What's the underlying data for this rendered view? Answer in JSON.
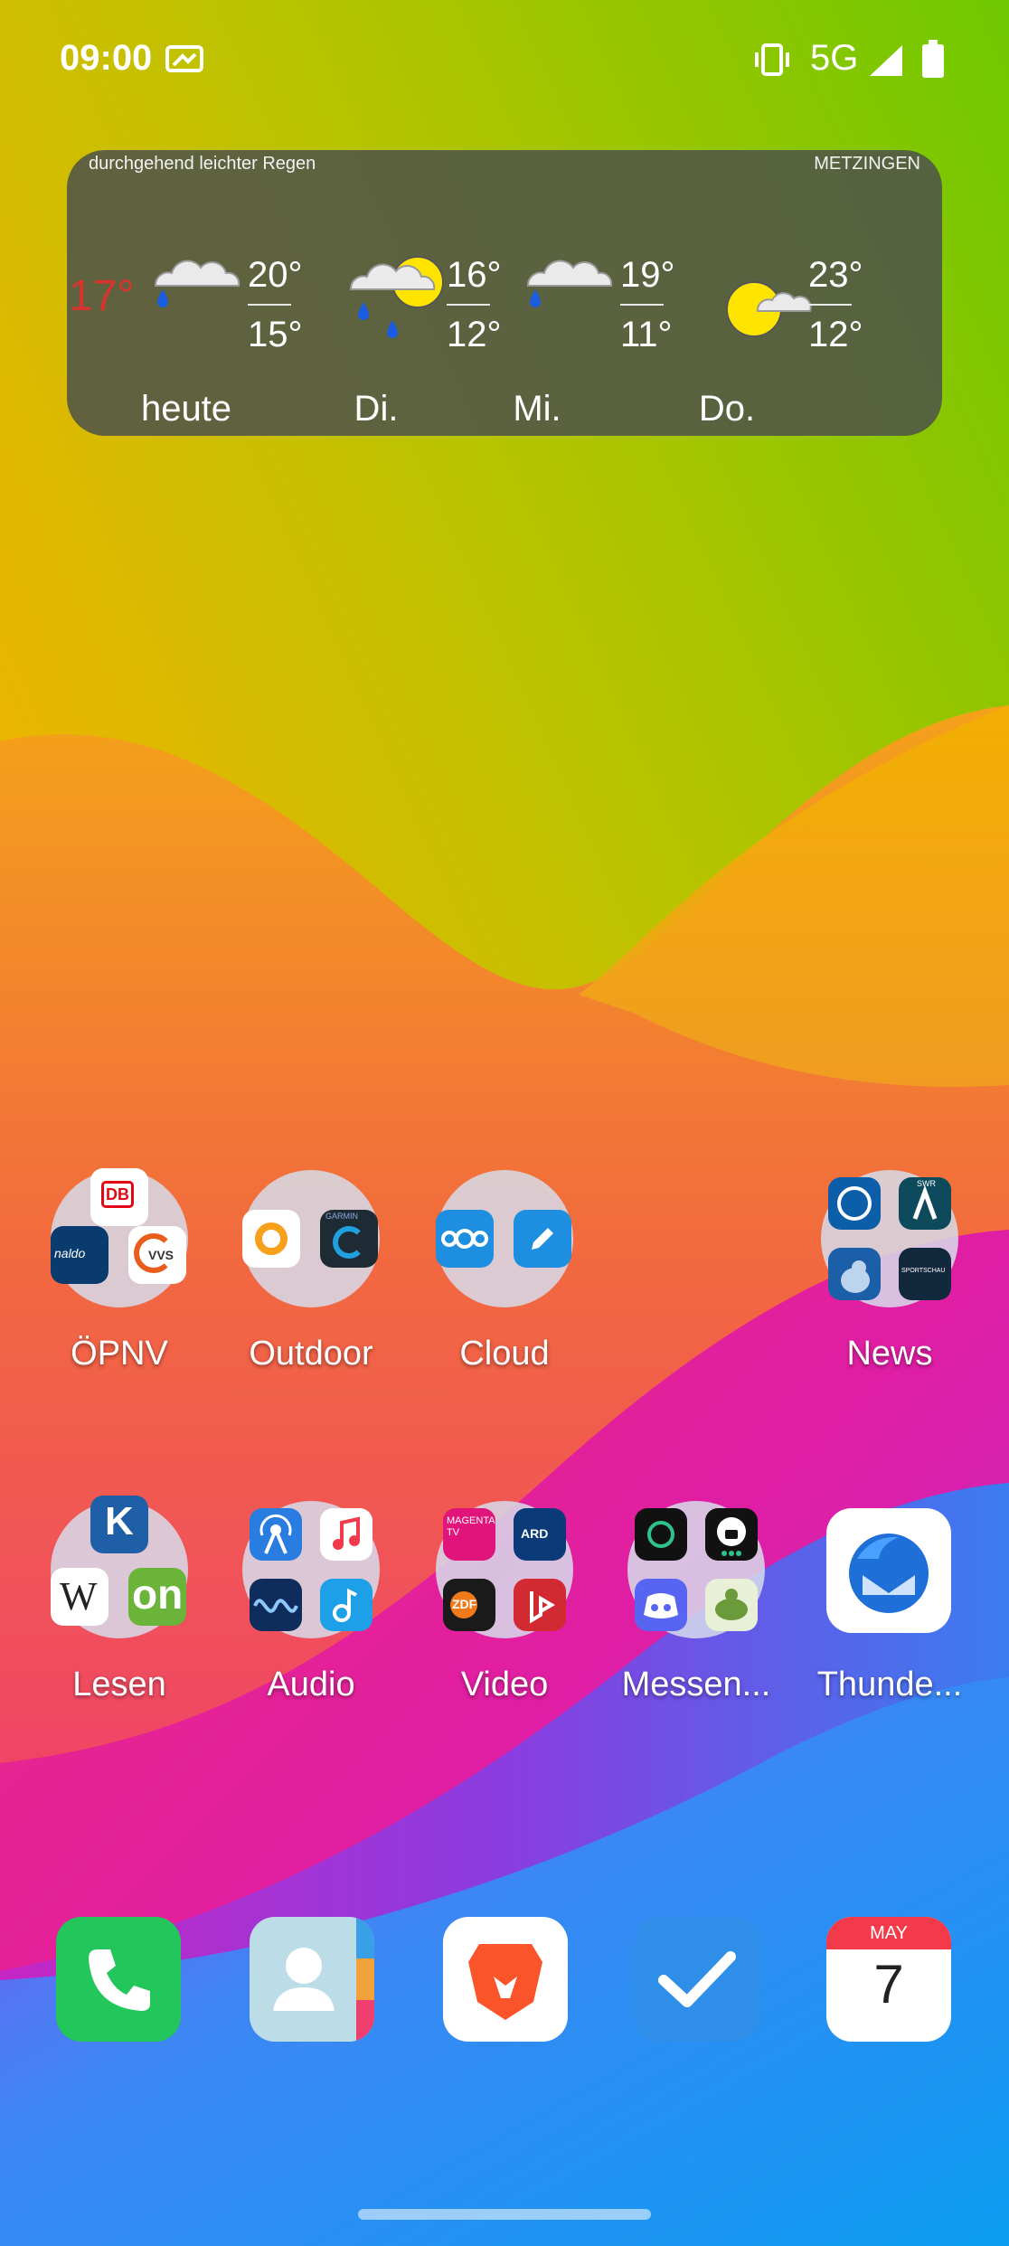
{
  "status_bar": {
    "time": "09:00",
    "network": "5G"
  },
  "weather": {
    "description": "durchgehend leichter Regen",
    "location": "METZINGEN",
    "current_temp": "17°",
    "days": [
      {
        "label": "heute",
        "high": "20°",
        "low": "15°",
        "icon": "cloud-rain-icon"
      },
      {
        "label": "Di.",
        "high": "16°",
        "low": "12°",
        "icon": "sun-cloud-rain-icon"
      },
      {
        "label": "Mi.",
        "high": "19°",
        "low": "11°",
        "icon": "cloud-rain-icon"
      },
      {
        "label": "Do.",
        "high": "23°",
        "low": "12°",
        "icon": "sun-cloud-icon"
      }
    ]
  },
  "folders": {
    "opnv": "ÖPNV",
    "outdoor": "Outdoor",
    "cloud": "Cloud",
    "news": "News",
    "lesen": "Lesen",
    "audio": "Audio",
    "video": "Video",
    "messenger": "Messen...",
    "thunderbird": "Thunde..."
  },
  "mini_labels": {
    "db": "DB",
    "vvs": "VVS",
    "naldo": "naldo",
    "garmin": "GARMIN",
    "swr": "SWR",
    "sportschau": "SPORTSCHAU",
    "magenta": "MAGENTA TV",
    "ard": "ARD",
    "zdf": "ZDF",
    "wiki": "W",
    "on": "on"
  },
  "dock": {
    "calendar_month": "MAY",
    "calendar_day": "7"
  },
  "colors": {
    "widget_bg": "#505448",
    "current_temp": "#d8342e",
    "phone_green": "#22c65a",
    "brave_orange": "#fb542b",
    "tasks_blue": "#2f8ee8"
  }
}
